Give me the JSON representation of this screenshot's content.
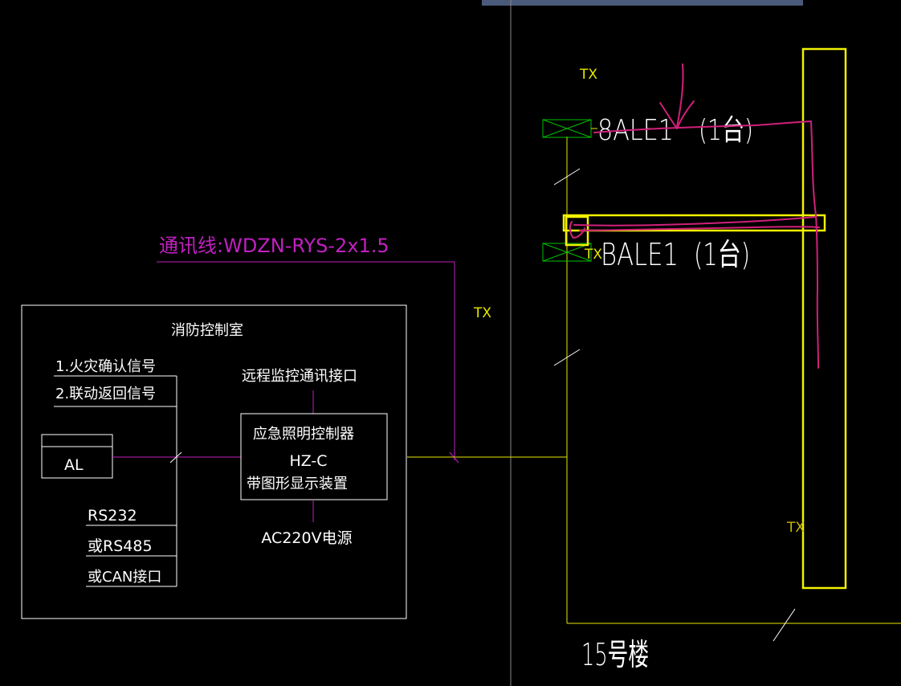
{
  "labels": {
    "comm_line": "通讯线:WDZN-RYS-2x1.5",
    "control_room": "消防控制室",
    "fire_signal": "1.火灾确认信号",
    "linkage_signal": "2.联动返回信号",
    "al": "AL",
    "rs232": "RS232",
    "rs485": "或RS485",
    "can": "或CAN接口",
    "remote_interface": "远程监控通讯接口",
    "controller_line1": "应急照明控制器",
    "controller_line2": "HZ-C",
    "controller_line3": "带图形显示装置",
    "power": "AC220V电源",
    "tx_top": "TX",
    "tx_mid": "TX",
    "tx_box": "TX",
    "tx_bottom": "TX",
    "ale_8": "8ALE1",
    "ale_8_qty": "(1台)",
    "bale": "BALE1",
    "bale_qty": "(1台)",
    "building": "15号楼"
  },
  "colors": {
    "background": "#000000",
    "white_line": "#ffffff",
    "magenta": "#c020c0",
    "yellow": "#e6e600",
    "green": "#00c000",
    "annotation": "#d0207a",
    "top_bar": "#4a5a7a"
  }
}
